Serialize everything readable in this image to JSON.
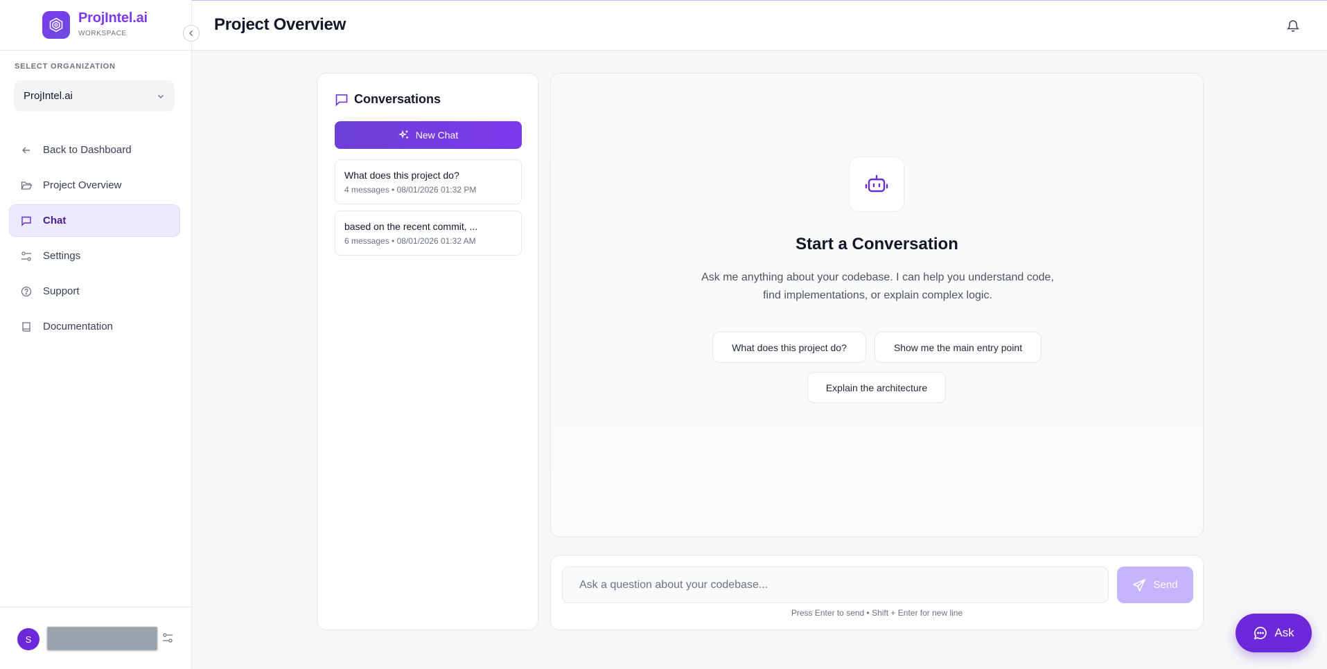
{
  "brand": {
    "name": "ProjIntel.ai",
    "subtitle": "WORKSPACE"
  },
  "organization": {
    "label": "SELECT ORGANIZATION",
    "selected": "ProjIntel.ai"
  },
  "nav": [
    {
      "label": "Back to Dashboard",
      "icon": "arrow-left-icon"
    },
    {
      "label": "Project Overview",
      "icon": "folder-open-icon"
    },
    {
      "label": "Chat",
      "icon": "message-square-icon",
      "active": true
    },
    {
      "label": "Settings",
      "icon": "sliders-icon"
    },
    {
      "label": "Support",
      "icon": "help-circle-icon"
    },
    {
      "label": "Documentation",
      "icon": "book-icon"
    }
  ],
  "user": {
    "initial": "S"
  },
  "header": {
    "title": "Project Overview"
  },
  "conversations": {
    "title": "Conversations",
    "new_chat": "New Chat",
    "items": [
      {
        "title": "What does this project do?",
        "meta": "4 messages • 08/01/2026 01:32 PM"
      },
      {
        "title": "based on the recent commit, ...",
        "meta": "6 messages • 08/01/2026 01:32 AM"
      }
    ]
  },
  "empty_state": {
    "title": "Start a Conversation",
    "description": "Ask me anything about your codebase. I can help you understand code, find implementations, or explain complex logic.",
    "suggestions": [
      "What does this project do?",
      "Show me the main entry point",
      "Explain the architecture"
    ]
  },
  "composer": {
    "placeholder": "Ask a question about your codebase...",
    "send": "Send",
    "hint": "Press Enter to send • Shift + Enter for new line"
  },
  "fab": {
    "label": "Ask"
  },
  "colors": {
    "accent": "#7c3aed",
    "active_bg": "#ede9fe",
    "send_disabled": "#c4b5fd"
  }
}
